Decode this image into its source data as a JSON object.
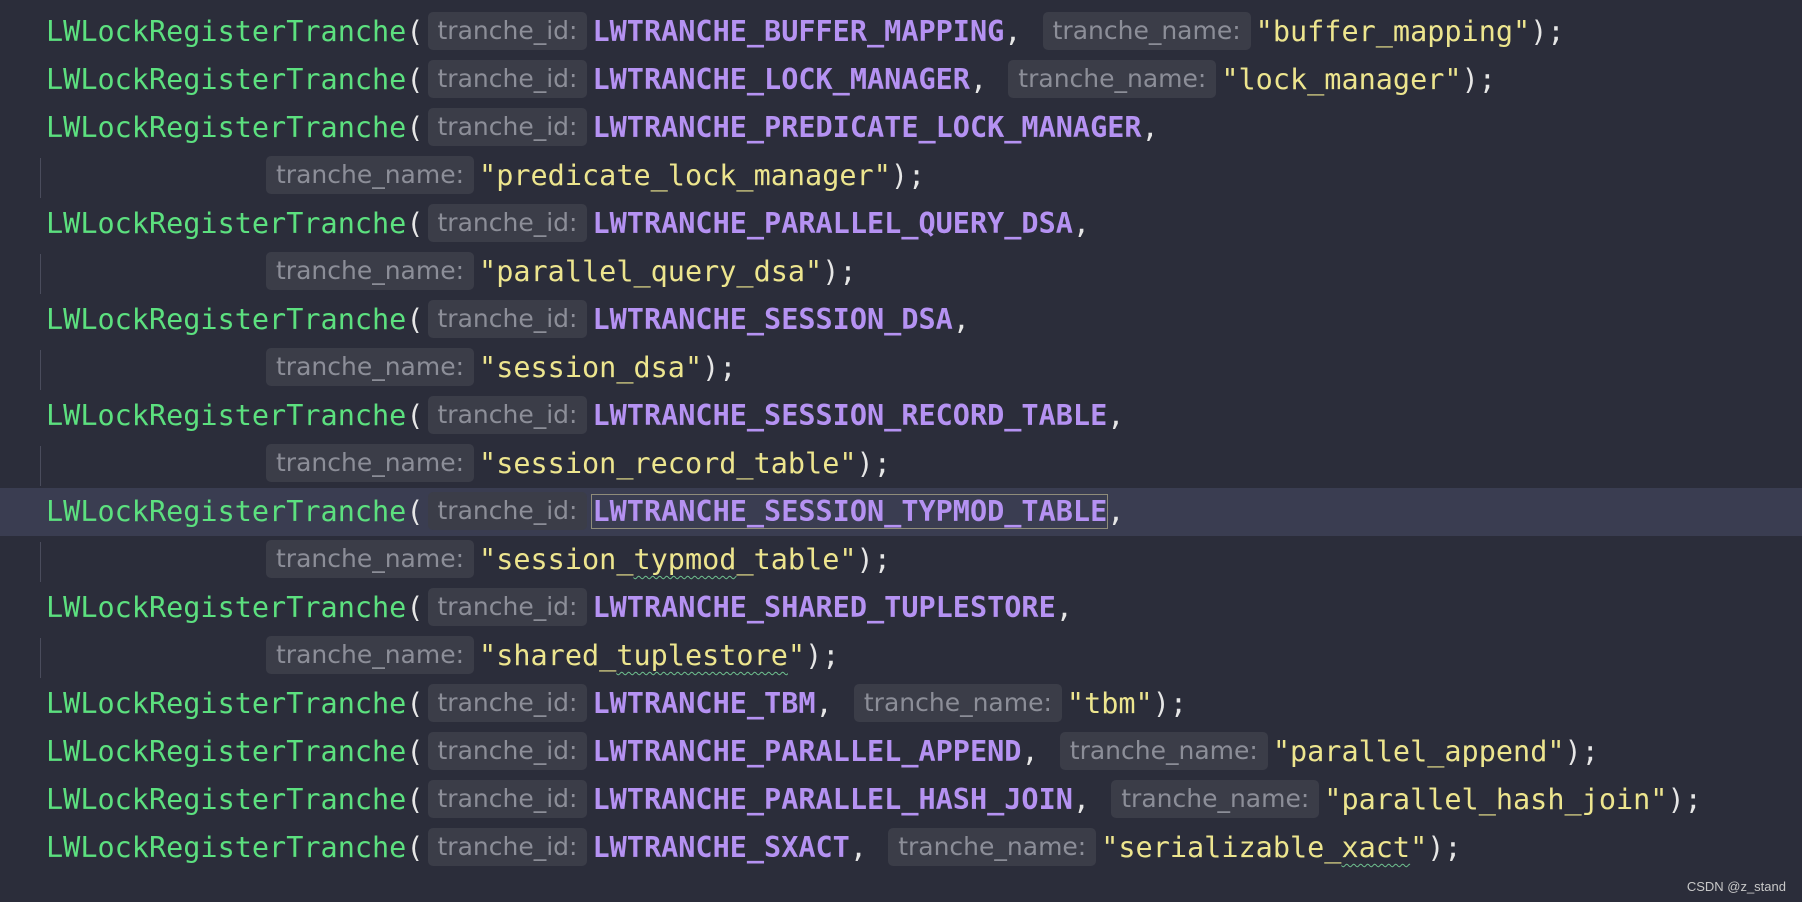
{
  "code": {
    "function_name": "LWLockRegisterTranche",
    "hint_id": "tranche_id:",
    "hint_name": "tranche_name:",
    "calls": [
      {
        "const": "LWTRANCHE_BUFFER_MAPPING",
        "str": "\"buffer_mapping\""
      },
      {
        "const": "LWTRANCHE_LOCK_MANAGER",
        "str": "\"lock_manager\""
      },
      {
        "const": "LWTRANCHE_PREDICATE_LOCK_MANAGER",
        "str": "\"predicate_lock_manager\""
      },
      {
        "const": "LWTRANCHE_PARALLEL_QUERY_DSA",
        "str": "\"parallel_query_dsa\""
      },
      {
        "const": "LWTRANCHE_SESSION_DSA",
        "str": "\"session_dsa\""
      },
      {
        "const": "LWTRANCHE_SESSION_RECORD_TABLE",
        "str": "\"session_record_table\""
      },
      {
        "const": "LWTRANCHE_SESSION_TYPMOD_TABLE",
        "str_a": "\"session_",
        "str_b": "typmod",
        "str_c": "_table\""
      },
      {
        "const": "LWTRANCHE_SHARED_TUPLESTORE",
        "str_a": "\"shared_",
        "str_b": "tuplestore",
        "str_c": "\""
      },
      {
        "const": "LWTRANCHE_TBM",
        "str": "\"tbm\""
      },
      {
        "const": "LWTRANCHE_PARALLEL_APPEND",
        "str": "\"parallel_append\""
      },
      {
        "const": "LWTRANCHE_PARALLEL_HASH_JOIN",
        "str": "\"parallel_hash_join\""
      },
      {
        "const": "LWTRANCHE_SXACT",
        "str_a": "\"serializable_",
        "str_b": "xact",
        "str_c": "\""
      }
    ]
  },
  "colors": {
    "background": "#2b2d3a",
    "function": "#5ce07f",
    "constant": "#b592f2",
    "string": "#ede58e",
    "hint_bg": "#3b3d48",
    "current_line": "#3a3d51"
  },
  "watermark": "CSDN @z_stand"
}
